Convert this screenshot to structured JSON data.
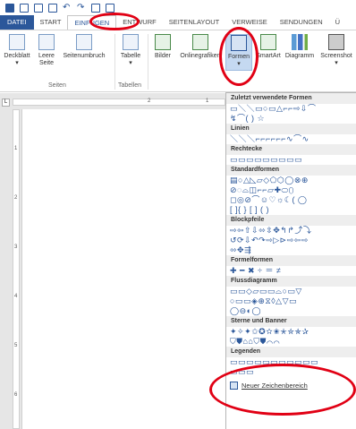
{
  "quick_access": {
    "icons": [
      "word-icon",
      "new-icon",
      "save-icon",
      "open-icon",
      "undo-icon",
      "redo-icon",
      "print-preview-icon",
      "customize-icon"
    ],
    "undo_glyph": "↶",
    "redo_glyph": "↷"
  },
  "tabs": [
    "DATEI",
    "START",
    "EINFÜGEN",
    "ENTWURF",
    "SEITENLAYOUT",
    "VERWEISE",
    "SENDUNGEN",
    "Ü"
  ],
  "ribbon": {
    "buttons": [
      {
        "label": "Deckblatt",
        "sub": "▾"
      },
      {
        "label": "Leere",
        "sub": "Seite"
      },
      {
        "label": "Seitenumbruch",
        "sub": ""
      },
      {
        "label": "Tabelle",
        "sub": "▾"
      },
      {
        "label": "Bilder",
        "sub": ""
      },
      {
        "label": "Onlinegrafiken",
        "sub": ""
      },
      {
        "label": "Formen",
        "sub": "▾"
      },
      {
        "label": "SmartArt",
        "sub": ""
      },
      {
        "label": "Diagramm",
        "sub": ""
      },
      {
        "label": "Screenshot",
        "sub": "▾"
      }
    ],
    "groups": [
      "Seiten",
      "Tabellen"
    ]
  },
  "ruler": {
    "top_marks": [
      "2",
      "1"
    ],
    "left_marks": [
      "1",
      "2",
      "3",
      "4",
      "5",
      "6"
    ],
    "tab_marker": "L"
  },
  "shapes_panel": {
    "sections": [
      {
        "title": "Zuletzt verwendete Formen",
        "rows": [
          "▭＼＼▭○▭△⌐⌐⇨⇩⌒",
          "↯⌒( ) ☆"
        ]
      },
      {
        "title": "Linien",
        "rows": [
          "＼＼＼⌐⌐⌐⌐⌐⌐∿⌒∿"
        ]
      },
      {
        "title": "Rechtecke",
        "rows": [
          "▭▭▭▭▭▭▭▭▭"
        ]
      },
      {
        "title": "Standardformen",
        "rows": [
          "▤○△◺▱◇⬠⬡◯⊗⊕",
          "⊘◌⌓◫⌐⌐▱✚⬭⬯",
          "◻◎⊘⌒☺♡☼☾( ◯",
          "[ ]{ } [ ] ( )"
        ]
      },
      {
        "title": "Blockpfeile",
        "rows": [
          "⇨⇦⇧⇩⬄⇳✥↰↱⤴⤵",
          "↺⟳⇩↶↷⇨▷⊳⇨⇦⇨",
          "⬄✥⇶"
        ]
      },
      {
        "title": "Formelformen",
        "rows": [
          "✚ ━ ✖ ÷ ＝ ≠"
        ]
      },
      {
        "title": "Flussdiagramm",
        "rows": [
          "▭▭◇▱▭▭⌓○▭▽",
          "○▭▭◈⊕⧖◊△▽▭",
          "◯⊖◐◯"
        ]
      },
      {
        "title": "Sterne und Banner",
        "rows": [
          "✦✧✦✩✪✫✬✭✮✯✰",
          "⛉⛊⌂⌂⛉⛊⌒⌒"
        ]
      },
      {
        "title": "Legenden",
        "rows": [
          "▭▭▭▭▭▭▭▭▭▭▭",
          "▭▭▭"
        ]
      }
    ],
    "footer_label": "Neuer Zeichenbereich"
  },
  "annotations": [
    "einfuegen-tab",
    "formen-button",
    "legenden-section"
  ]
}
